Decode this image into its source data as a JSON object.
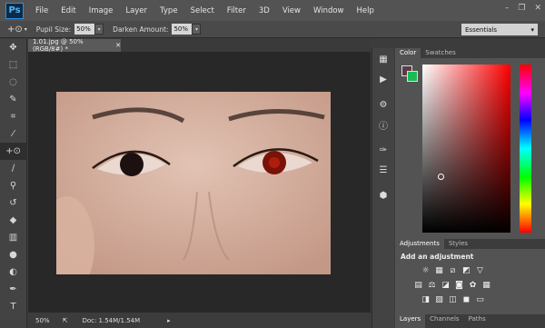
{
  "app": {
    "logo": "Ps"
  },
  "menu": [
    "File",
    "Edit",
    "Image",
    "Layer",
    "Type",
    "Select",
    "Filter",
    "3D",
    "View",
    "Window",
    "Help"
  ],
  "window_controls": [
    "minimize-icon",
    "restore-icon",
    "close-icon"
  ],
  "options": {
    "pupil_label": "Pupil Size:",
    "pupil_value": "50%",
    "darken_label": "Darken Amount:",
    "darken_value": "50%"
  },
  "workspace": "Essentials",
  "document": {
    "tab": "1.01.jpg @ 50% (RGB/8#) *"
  },
  "status": {
    "zoom": "50%",
    "doc": "Doc: 1.54M/1.54M"
  },
  "panels": {
    "color_tabs": [
      "Color",
      "Swatches"
    ],
    "adjust_tabs": [
      "Adjustments",
      "Styles"
    ],
    "adjust_heading": "Add an adjustment",
    "layer_tabs": [
      "Layers",
      "Channels",
      "Paths"
    ]
  },
  "colors": {
    "foreground": "#5a3b48",
    "background": "#1db954"
  },
  "tools": [
    "move",
    "marquee",
    "lasso",
    "quick-select",
    "crop",
    "eyedropper",
    "red-eye",
    "brush",
    "clone-stamp",
    "history-brush",
    "eraser",
    "gradient",
    "blur",
    "dodge",
    "pen",
    "type"
  ]
}
